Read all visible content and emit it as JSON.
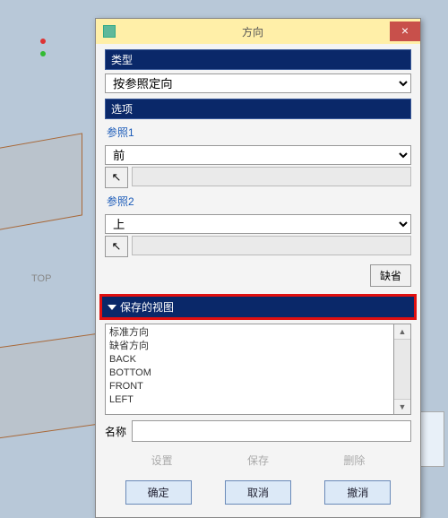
{
  "bg": {
    "top_label": "TOP"
  },
  "dialog": {
    "title": "方向",
    "type": {
      "header": "类型",
      "value": "按参照定向"
    },
    "options": {
      "header": "选项",
      "ref1": {
        "label": "参照1",
        "value": "前"
      },
      "ref2": {
        "label": "参照2",
        "value": "上"
      },
      "default_btn": "缺省"
    },
    "saved": {
      "header": "保存的视图",
      "items": [
        "标准方向",
        "缺省方向",
        "BACK",
        "BOTTOM",
        "FRONT",
        "LEFT"
      ],
      "name_label": "名称",
      "set": "设置",
      "save": "保存",
      "delete": "删除"
    },
    "actions": {
      "ok": "确定",
      "cancel": "取消",
      "undo": "撤消"
    }
  }
}
